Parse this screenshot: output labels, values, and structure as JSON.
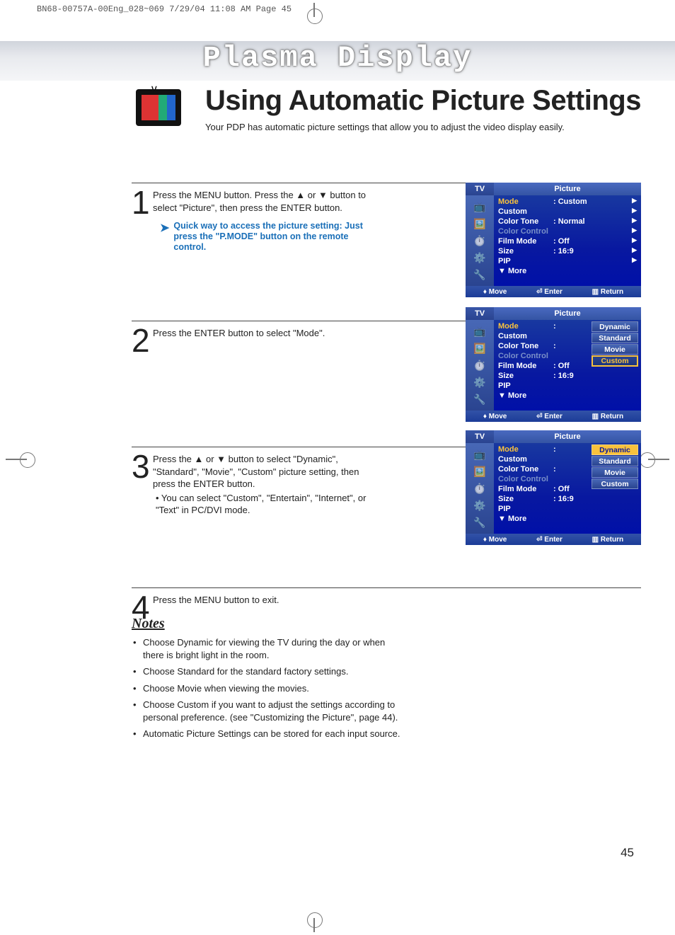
{
  "print_header": "BN68-00757A-00Eng_028~069  7/29/04  11:08 AM  Page 45",
  "banner_title": "Plasma Display",
  "page_title": "Using Automatic Picture Settings",
  "page_subtitle": "Your PDP has automatic picture settings that allow you to adjust the video display easily.",
  "page_number": "45",
  "steps": {
    "s1_num": "1",
    "s1_text": "Press the MENU button. Press the ▲ or ▼ button to select \"Picture\", then press the ENTER button.",
    "s1_tip": "Quick way to access the picture setting: Just press the \"P.MODE\" button on the remote control.",
    "s2_num": "2",
    "s2_text": "Press the ENTER button to select \"Mode\".",
    "s3_num": "3",
    "s3_text": "Press the ▲ or ▼ button to select \"Dynamic\", \"Standard\", \"Movie\", \"Custom\" picture setting, then press the ENTER button.",
    "s3_sub": "• You can select \"Custom\", \"Entertain\", \"Internet\", or \"Text\" in PC/DVI mode.",
    "s4_num": "4",
    "s4_text": "Press the MENU button to exit."
  },
  "osd_common": {
    "tv": "TV",
    "title": "Picture",
    "footer_move": "Move",
    "footer_enter": "Enter",
    "footer_return": "Return",
    "more": "▼ More"
  },
  "osd1": {
    "rows": [
      {
        "label": "Mode",
        "val": ":  Custom",
        "sel": true,
        "arrow": true
      },
      {
        "label": "Custom",
        "val": "",
        "arrow": true
      },
      {
        "label": "Color Tone",
        "val": ":  Normal",
        "arrow": true
      },
      {
        "label": "Color Control",
        "val": "",
        "dim": true,
        "arrow": true
      },
      {
        "label": "Film Mode",
        "val": ":  Off",
        "arrow": true
      },
      {
        "label": "Size",
        "val": ":  16:9",
        "arrow": true
      },
      {
        "label": "PIP",
        "val": "",
        "arrow": true
      }
    ]
  },
  "osd2": {
    "rows": [
      {
        "label": "Mode",
        "val": ":",
        "sel": true
      },
      {
        "label": "Custom",
        "val": ""
      },
      {
        "label": "Color Tone",
        "val": ":"
      },
      {
        "label": "Color Control",
        "val": "",
        "dim": true
      },
      {
        "label": "Film Mode",
        "val": ":  Off"
      },
      {
        "label": "Size",
        "val": ":  16:9"
      },
      {
        "label": "PIP",
        "val": ""
      }
    ],
    "options": [
      {
        "label": "Dynamic",
        "style": "norm"
      },
      {
        "label": "Standard",
        "style": "norm"
      },
      {
        "label": "Movie",
        "style": "norm"
      },
      {
        "label": "Custom",
        "style": "sel"
      }
    ]
  },
  "osd3": {
    "rows": [
      {
        "label": "Mode",
        "val": ":",
        "sel": true
      },
      {
        "label": "Custom",
        "val": ""
      },
      {
        "label": "Color Tone",
        "val": ":"
      },
      {
        "label": "Color Control",
        "val": "",
        "dim": true
      },
      {
        "label": "Film Mode",
        "val": ":  Off"
      },
      {
        "label": "Size",
        "val": ":  16:9"
      },
      {
        "label": "PIP",
        "val": ""
      }
    ],
    "options": [
      {
        "label": "Dynamic",
        "style": "hi"
      },
      {
        "label": "Standard",
        "style": "norm"
      },
      {
        "label": "Movie",
        "style": "norm"
      },
      {
        "label": "Custom",
        "style": "norm"
      }
    ]
  },
  "notes": {
    "heading": "Notes",
    "items": [
      "Choose Dynamic for viewing the TV during the day or when there is bright light in the room.",
      "Choose Standard for the standard factory settings.",
      "Choose Movie when viewing the movies.",
      "Choose Custom if you want to adjust the settings according to personal preference. (see \"Customizing the Picture\", page 44).",
      "Automatic Picture Settings can be stored for each input source."
    ]
  }
}
